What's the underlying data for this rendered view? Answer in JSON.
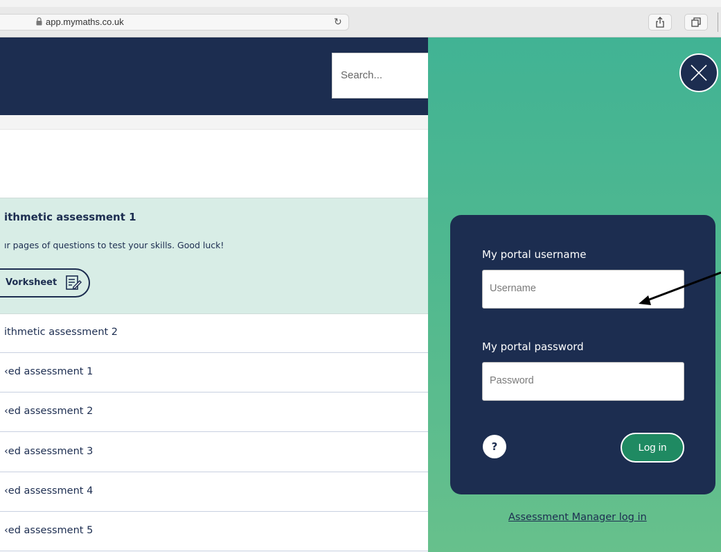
{
  "browser": {
    "url": "app.mymaths.co.uk",
    "lock_icon": "lock-icon",
    "reload_icon": "reload-icon",
    "share_icon": "share-icon",
    "tabs_icon": "tabs-icon"
  },
  "header": {
    "search_placeholder": "Search..."
  },
  "assessments": {
    "active": {
      "title": "ithmetic assessment 1",
      "description": "ır pages of questions to test your skills. Good luck!",
      "worksheet_label": "Vorksheet"
    },
    "items": [
      {
        "label": "ithmetic assessment 2"
      },
      {
        "label": "‹ed assessment 1"
      },
      {
        "label": "‹ed assessment 2"
      },
      {
        "label": "‹ed assessment 3"
      },
      {
        "label": "‹ed assessment 4"
      },
      {
        "label": "‹ed assessment 5"
      }
    ]
  },
  "login": {
    "username_label": "My portal username",
    "username_placeholder": "Username",
    "password_label": "My portal password",
    "password_placeholder": "Password",
    "help_label": "?",
    "login_label": "Log in",
    "assessment_manager_link": "Assessment Manager log in"
  },
  "colors": {
    "navy": "#1c2d50",
    "green_panel": "#41b394",
    "login_button": "#1f8a62",
    "active_card": "#d8ede6"
  }
}
